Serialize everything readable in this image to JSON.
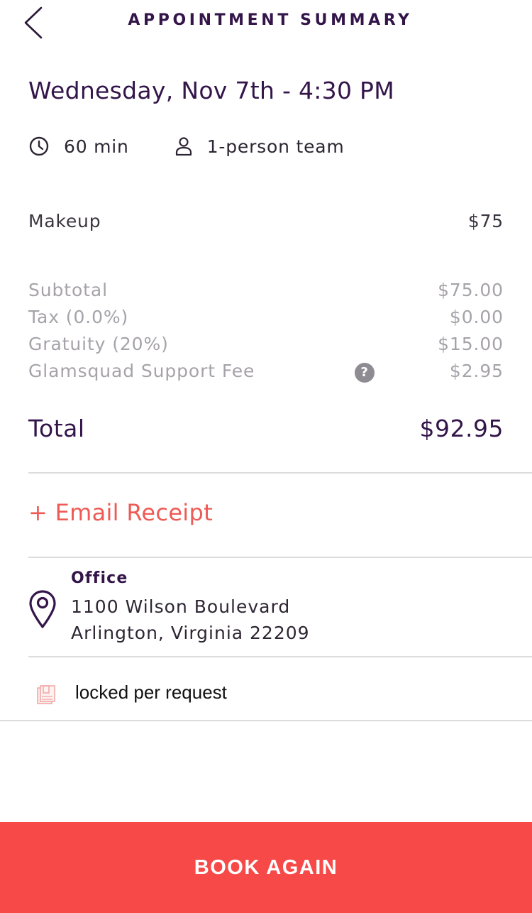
{
  "header": {
    "title": "APPOINTMENT SUMMARY",
    "back_icon": "chevron-left-icon"
  },
  "appointment": {
    "datetime": "Wednesday, Nov 7th - 4:30 PM",
    "duration": "60 min",
    "team": "1-person team"
  },
  "services": [
    {
      "name": "Makeup",
      "price": "$75"
    }
  ],
  "fees": {
    "subtotal": {
      "label": "Subtotal",
      "value": "$75.00"
    },
    "tax": {
      "label": "Tax (0.0%)",
      "value": "$0.00"
    },
    "gratuity": {
      "label": "Gratuity (20%)",
      "value": "$15.00"
    },
    "support_fee": {
      "label": "Glamsquad Support Fee",
      "value": "$2.95",
      "help_glyph": "?"
    }
  },
  "total": {
    "label": "Total",
    "value": "$92.95"
  },
  "email_receipt": "+ Email Receipt",
  "location": {
    "label": "Office",
    "line1": "1100 Wilson Boulevard",
    "line2": "Arlington, Virginia 22209"
  },
  "note": "locked per request",
  "book_again": "BOOK AGAIN",
  "colors": {
    "primary_purple": "#33154a",
    "accent_coral": "#ee5a55",
    "button_red": "#f74a48",
    "muted_gray": "#a6a2a9"
  }
}
